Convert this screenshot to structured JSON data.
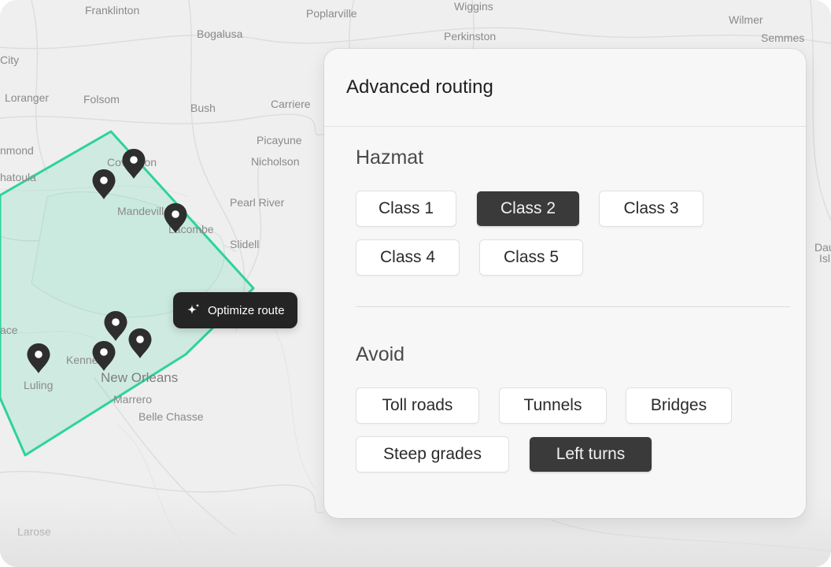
{
  "map": {
    "labels": [
      "Franklinton",
      "Poplarville",
      "Wiggins",
      "Wilmer",
      "Semmes",
      "Bogalusa",
      "Perkinston",
      "City",
      "Loranger",
      "Folsom",
      "Bush",
      "Carriere",
      "Picayune",
      "nmond",
      "Nicholson",
      "Covington",
      "hatoula",
      "Mandeville",
      "Pearl River",
      "Lacombe",
      "Slidell",
      "Dau",
      "Isl",
      "ace",
      "Kenner",
      "New Orleans",
      "Luling",
      "Marrero",
      "Belle Chasse",
      "Larose"
    ],
    "region_color": "#2ed39a"
  },
  "tooltip": {
    "label": "Optimize route",
    "icon": "sparkle-icon"
  },
  "panel": {
    "title": "Advanced routing",
    "hazmat": {
      "title": "Hazmat",
      "options": [
        "Class 1",
        "Class 2",
        "Class 3",
        "Class 4",
        "Class 5"
      ],
      "selected": "Class 2"
    },
    "avoid": {
      "title": "Avoid",
      "options": [
        "Toll roads",
        "Tunnels",
        "Bridges",
        "Steep grades",
        "Left turns"
      ],
      "selected": "Left turns"
    }
  },
  "colors": {
    "selected_chip": "#3a3a3a",
    "tooltip_bg": "#242424",
    "pin": "#2e2e2e"
  }
}
